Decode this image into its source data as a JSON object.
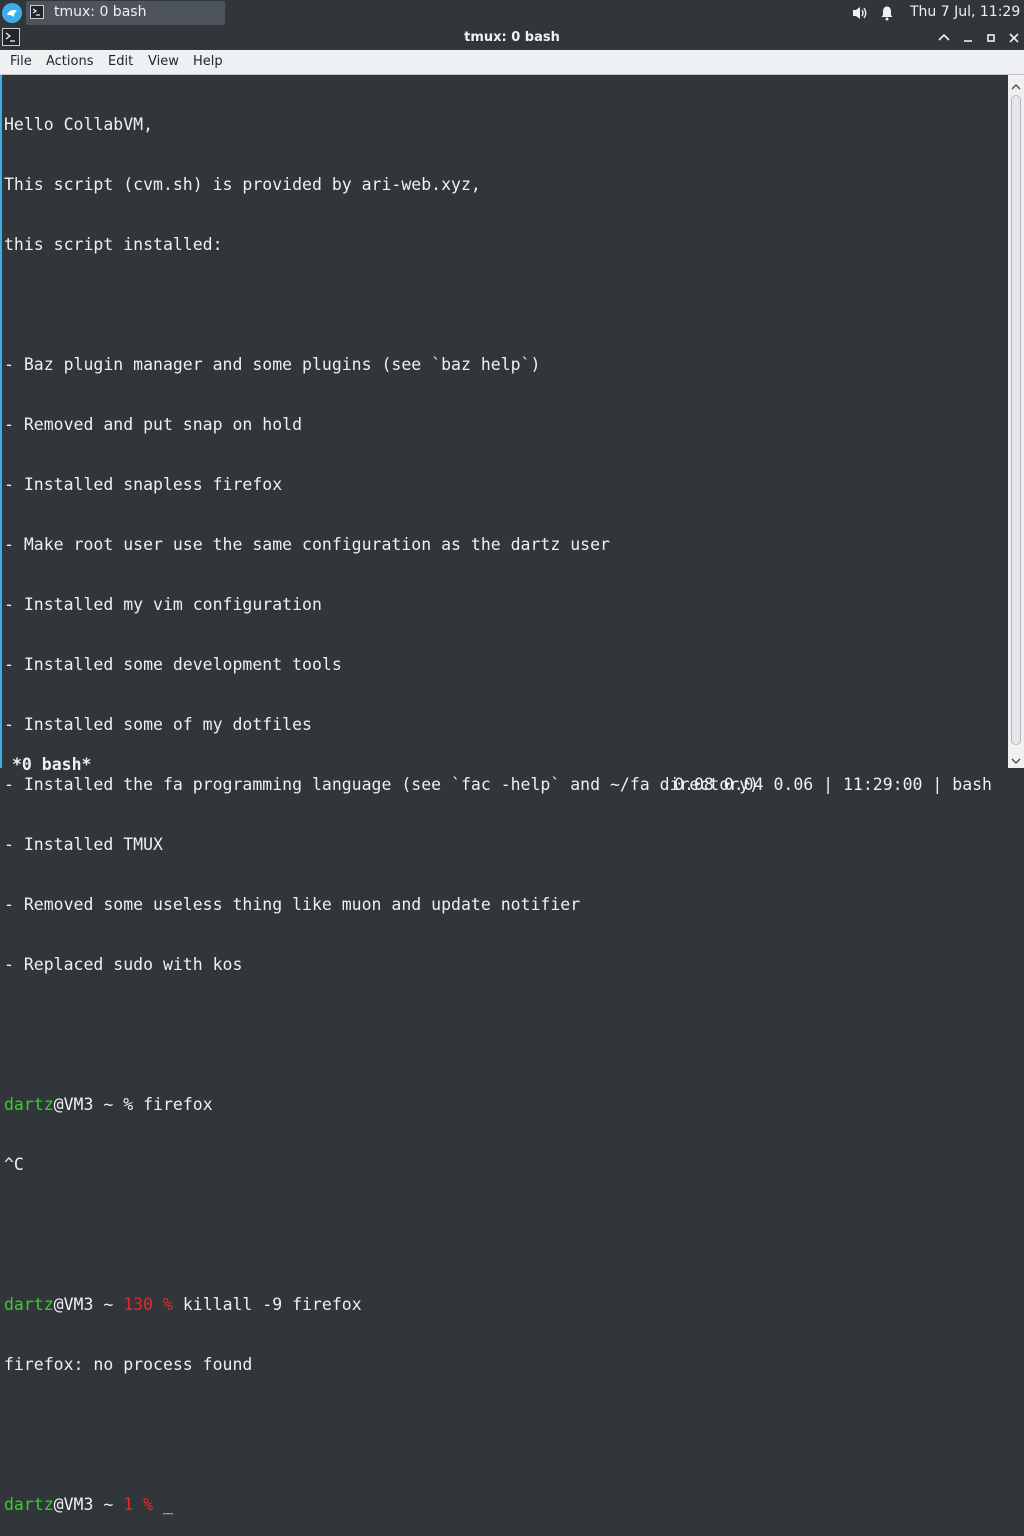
{
  "taskbar": {
    "task_label": "tmux: 0 bash",
    "clock": "Thu  7 Jul, 11:29",
    "icons": [
      "app-launcher-icon",
      "terminal-icon",
      "volume-icon",
      "notification-bell-icon"
    ]
  },
  "window": {
    "title": "tmux: 0 bash",
    "buttons": [
      "keep-above-icon",
      "minimize-icon",
      "maximize-icon",
      "close-icon"
    ]
  },
  "menu": {
    "file": "File",
    "actions": "Actions",
    "edit": "Edit",
    "view": "View",
    "help": "Help"
  },
  "terminal": {
    "lines": [
      "Hello CollabVM,",
      "This script (cvm.sh) is provided by ari-web.xyz,",
      "this script installed:",
      "",
      "- Baz plugin manager and some plugins (see `baz help`)",
      "- Removed and put snap on hold",
      "- Installed snapless firefox",
      "- Make root user use the same configuration as the dartz user",
      "- Installed my vim configuration",
      "- Installed some development tools",
      "- Installed some of my dotfiles",
      "- Installed the fa programming language (see `fac -help` and ~/fa directory)",
      "- Installed TMUX",
      "- Removed some useless thing like muon and update notifier",
      "- Replaced sudo with kos",
      ""
    ],
    "prompt1": {
      "user": "dartz",
      "host": "@VM3 ~ ",
      "symbol": "% ",
      "command": "firefox"
    },
    "output1": "^C",
    "prompt2": {
      "user": "dartz",
      "host": "@VM3 ~ ",
      "status": "130 % ",
      "command": "killall -9 firefox"
    },
    "output2": "firefox: no process found",
    "prompt3": {
      "user": "dartz",
      "host": "@VM3 ~ ",
      "status": "1 % ",
      "cursor": "_"
    }
  },
  "tmux": {
    "window": "*0 bash*",
    "status_right": "0.08 0.04 0.06 | 11:29:00 | bash"
  },
  "colors": {
    "background": "#31363b",
    "accent": "#3daee9",
    "prompt_user": "#3ccd2f",
    "error_status": "#e02a2a",
    "menubar": "#eff0f1"
  }
}
